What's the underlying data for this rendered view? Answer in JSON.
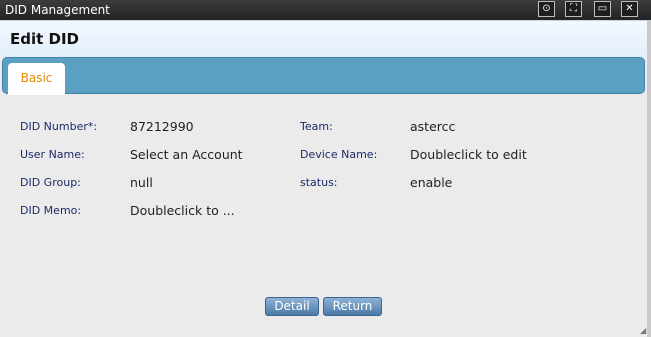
{
  "window": {
    "title": "DID Management",
    "controls": [
      {
        "name": "restore-icon",
        "glyph": "⊙"
      },
      {
        "name": "maximize-icon",
        "glyph": "⛶"
      },
      {
        "name": "minimize-icon",
        "glyph": "▭"
      },
      {
        "name": "close-icon",
        "glyph": "✕"
      }
    ]
  },
  "panel": {
    "heading": "Edit DID"
  },
  "tabs": [
    {
      "label": "Basic",
      "active": true
    }
  ],
  "fields": {
    "did_number": {
      "label": "DID Number*:",
      "value": "87212990"
    },
    "team": {
      "label": "Team:",
      "value": "astercc"
    },
    "user_name": {
      "label": "User Name:",
      "value": "Select an Account"
    },
    "device_name": {
      "label": "Device Name:",
      "value": "Doubleclick to edit"
    },
    "did_group": {
      "label": "DID Group:",
      "value": "null"
    },
    "status": {
      "label": "status:",
      "value": "enable"
    },
    "did_memo": {
      "label": "DID Memo:",
      "value": "Doubleclick to ..."
    }
  },
  "buttons": {
    "detail": "Detail",
    "return": "Return"
  },
  "colors": {
    "accent_tab_text": "#e08a00",
    "tabbar": "#5b9fc2",
    "label_text": "#1c2a66",
    "button": "#5a85b4"
  }
}
